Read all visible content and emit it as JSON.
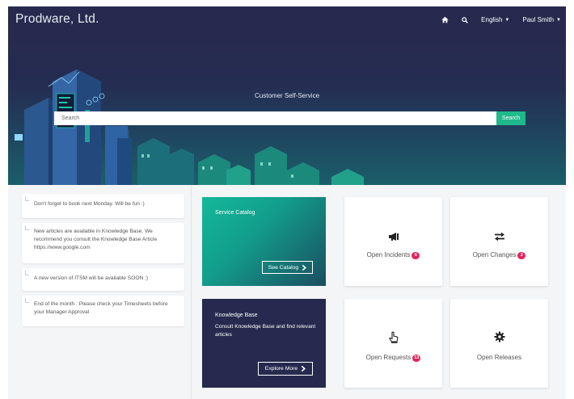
{
  "app": {
    "brand": "Prodware, Ltd."
  },
  "navbar": {
    "home_icon": "home-icon",
    "search_icon": "search-icon",
    "language": "English",
    "user": "Paul Smith"
  },
  "hero": {
    "title": "Customer Self-Service",
    "search_placeholder": "Search",
    "search_button": "Search"
  },
  "news": [
    {
      "text": "Don't forget to book next Monday. Will be fun :)"
    },
    {
      "text": "New articles are available in Knowledge Base. We recommend you consult the Knowledge Base Article https://www.google.com"
    },
    {
      "text": "A new version of ITSM will be available SOON :)"
    },
    {
      "text": "End of the month : Please check your Timesheets before your Manager Approval"
    }
  ],
  "service_catalog": {
    "title": "Service Catalog",
    "button": "See Catalog"
  },
  "knowledge_base": {
    "title": "Knowledge Base",
    "description": "Consult Knowledge Base and find relevant articles",
    "button": "Explore More"
  },
  "tiles": {
    "incidents": {
      "label": "Open Incidents",
      "count": "6",
      "icon": "megaphone-icon"
    },
    "changes": {
      "label": "Open Changes",
      "count": "2",
      "icon": "swap-arrows-icon"
    },
    "requests": {
      "label": "Open Requests",
      "count": "13",
      "icon": "hand-pointer-icon"
    },
    "releases": {
      "label": "Open Releases",
      "icon": "gear-icon"
    }
  },
  "colors": {
    "navy": "#272a4e",
    "teal": "#1fb98b",
    "badge": "#e3245c"
  }
}
